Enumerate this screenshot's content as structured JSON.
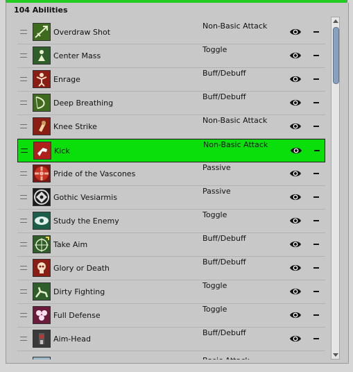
{
  "header": {
    "title": "104 Abilities"
  },
  "abilities": [
    {
      "name": "Overdraw Shot",
      "type": "Non-Basic Attack",
      "icon": "overdraw-shot-icon",
      "bg": "#3f6b1f",
      "fg": "#e8f0d0"
    },
    {
      "name": "Center Mass",
      "type": "Toggle",
      "icon": "center-mass-icon",
      "bg": "#2f5e2a",
      "fg": "#e8f0d0"
    },
    {
      "name": "Enrage",
      "type": "Buff/Debuff",
      "icon": "enrage-icon",
      "bg": "#8a1e14",
      "fg": "#f3e2c8"
    },
    {
      "name": "Deep Breathing",
      "type": "Buff/Debuff",
      "icon": "deep-breathing-icon",
      "bg": "#3f6b1f",
      "fg": "#e8f0d0"
    },
    {
      "name": "Knee Strike",
      "type": "Non-Basic Attack",
      "icon": "knee-strike-icon",
      "bg": "#8a1e14",
      "fg": "#f0d6a0"
    },
    {
      "name": "Kick",
      "type": "Non-Basic Attack",
      "icon": "kick-icon",
      "bg": "#b0201a",
      "fg": "#ffffff"
    },
    {
      "name": "Pride of the Vascones",
      "type": "Passive",
      "icon": "pride-of-the-vascones-icon",
      "bg": "#7a1a14",
      "fg": "#e8b0a0"
    },
    {
      "name": "Gothic Vesiarmis",
      "type": "Passive",
      "icon": "gothic-vesiarmis-icon",
      "bg": "#1a1a1a",
      "fg": "#dcdcdc"
    },
    {
      "name": "Study the Enemy",
      "type": "Toggle",
      "icon": "study-the-enemy-icon",
      "bg": "#1d5e4a",
      "fg": "#e0f0ea"
    },
    {
      "name": "Take Aim",
      "type": "Buff/Debuff",
      "icon": "take-aim-icon",
      "bg": "#2f5e2a",
      "fg": "#e8f0d0"
    },
    {
      "name": "Glory or Death",
      "type": "Buff/Debuff",
      "icon": "glory-or-death-icon",
      "bg": "#8a1e14",
      "fg": "#f3e2c8"
    },
    {
      "name": "Dirty Fighting",
      "type": "Toggle",
      "icon": "dirty-fighting-icon",
      "bg": "#2f5e2a",
      "fg": "#e8f0d0"
    },
    {
      "name": "Full Defense",
      "type": "Toggle",
      "icon": "full-defense-icon",
      "bg": "#6a1a3a",
      "fg": "#f5e0f0"
    },
    {
      "name": "Aim-Head",
      "type": "Buff/Debuff",
      "icon": "aim-head-icon",
      "bg": "#3a3a3a",
      "fg": "#d0c0c0"
    }
  ],
  "partial_row": {
    "type": "Basic Attack",
    "icon": "partial-ability-icon"
  },
  "selected_index": 5,
  "colors": {
    "selected": "#0bdf0b",
    "accent_strip": "#22cc22",
    "scroll_thumb": "#8aa0bf"
  }
}
